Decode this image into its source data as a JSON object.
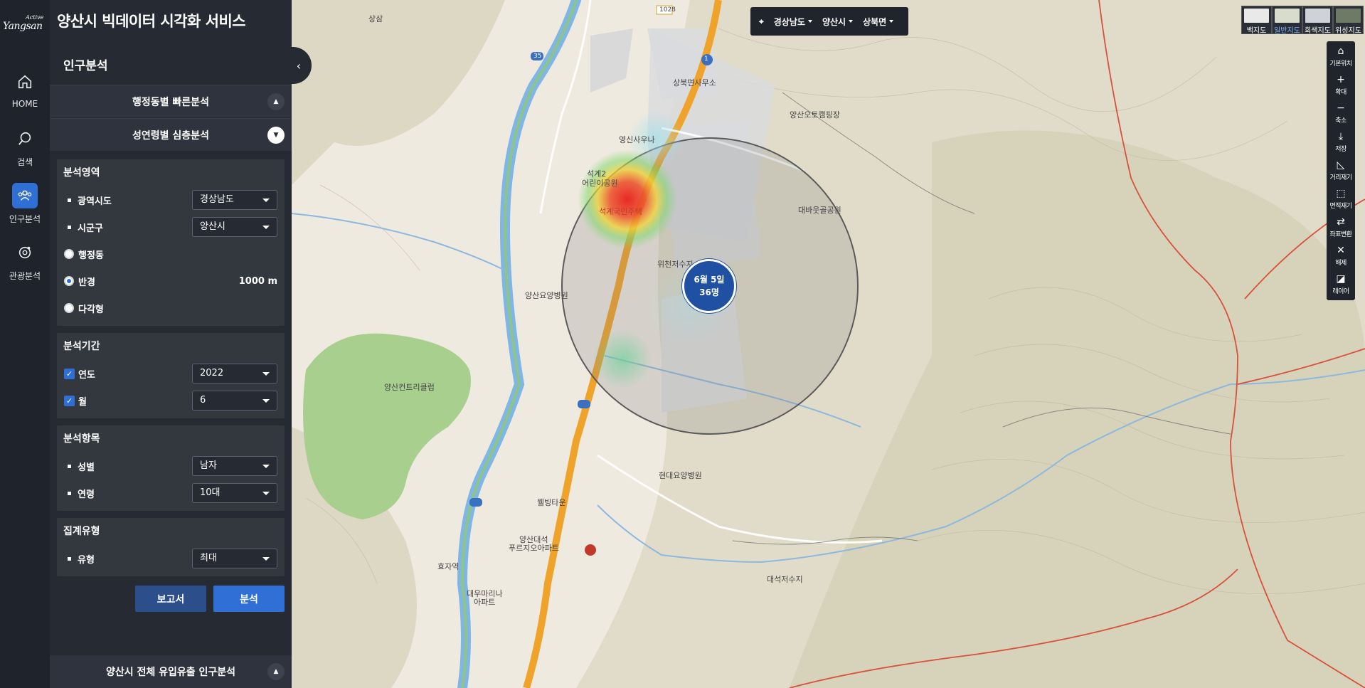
{
  "brand": {
    "logo_small": "Active",
    "logo_big": "Yangsan"
  },
  "app_title": "양산시 빅데이터 시각화 서비스",
  "rail": [
    {
      "label": "HOME",
      "icon": "home-icon"
    },
    {
      "label": "검색",
      "icon": "search-icon"
    },
    {
      "label": "인구분석",
      "icon": "people-icon"
    },
    {
      "label": "관광분석",
      "icon": "tourism-icon"
    }
  ],
  "panel": {
    "title": "인구분석",
    "quick_section": "행정동별 빠른분석",
    "deep_section": "성연령별 심층분석",
    "area": {
      "title": "분석영역",
      "sido_label": "광역시도",
      "sido_value": "경상남도",
      "sigungu_label": "시군구",
      "sigungu_value": "양산시",
      "radio_dong": "행정동",
      "radio_radius": "반경",
      "radius_value": "1000 m",
      "radio_polygon": "다각형"
    },
    "period": {
      "title": "분석기간",
      "year_label": "연도",
      "year_value": "2022",
      "month_label": "월",
      "month_value": "6"
    },
    "items": {
      "title": "분석항목",
      "gender_label": "성별",
      "gender_value": "남자",
      "age_label": "연령",
      "age_value": "10대"
    },
    "agg": {
      "title": "집계유형",
      "type_label": "유형",
      "type_value": "최대"
    },
    "report_button": "보고서",
    "analyze_button": "분석",
    "bottom_section": "양산시 전체 유입유출 인구분석"
  },
  "location_bar": {
    "sido": "경상남도",
    "sigungu": "양산시",
    "dong": "상북면"
  },
  "basemaps": [
    {
      "label": "백지도",
      "color": "#e9e9e9"
    },
    {
      "label": "일반지도",
      "color": "#d7dccd",
      "selected": true
    },
    {
      "label": "회색지도",
      "color": "#cfd2d6"
    },
    {
      "label": "위성지도",
      "color": "#6e7a66"
    }
  ],
  "tools": [
    {
      "label": "기본위치",
      "glyph": "⌂",
      "icon": "home-position-icon"
    },
    {
      "label": "확대",
      "glyph": "+",
      "icon": "zoom-in-icon"
    },
    {
      "label": "축소",
      "glyph": "−",
      "icon": "zoom-out-icon"
    },
    {
      "label": "저장",
      "glyph": "⤓",
      "icon": "download-icon"
    },
    {
      "label": "거리재기",
      "glyph": "◺",
      "icon": "ruler-icon"
    },
    {
      "label": "면적재기",
      "glyph": "⬚",
      "icon": "area-measure-icon"
    },
    {
      "label": "좌표변환",
      "glyph": "⇄",
      "icon": "coordinate-icon"
    },
    {
      "label": "해제",
      "glyph": "✕",
      "icon": "clear-icon"
    },
    {
      "label": "레이어",
      "glyph": "◪",
      "icon": "layers-icon"
    }
  ],
  "badge": {
    "line1": "6월 5일",
    "line2": "36명"
  },
  "map_labels": {
    "l1": "상북면사무소",
    "l2": "양산오토캠핑장",
    "l3": "영신사우나",
    "l4": "석계2",
    "l5": "어린이공원",
    "l6": "석계국민주택",
    "l7": "대바웃골공원",
    "l8": "위천저수지",
    "l9": "양산요양병원",
    "l10": "양산컨트리클럽",
    "l11": "현대요양병원",
    "l12": "웰빙타운",
    "l13": "양산대석",
    "l14": "푸르지오아파트",
    "l15": "대우마리나",
    "l16": "아파트",
    "l17": "효자역",
    "l18": "대석저수지",
    "l19": "상삼",
    "r1": "1028",
    "r2": "35",
    "r3": "1"
  }
}
